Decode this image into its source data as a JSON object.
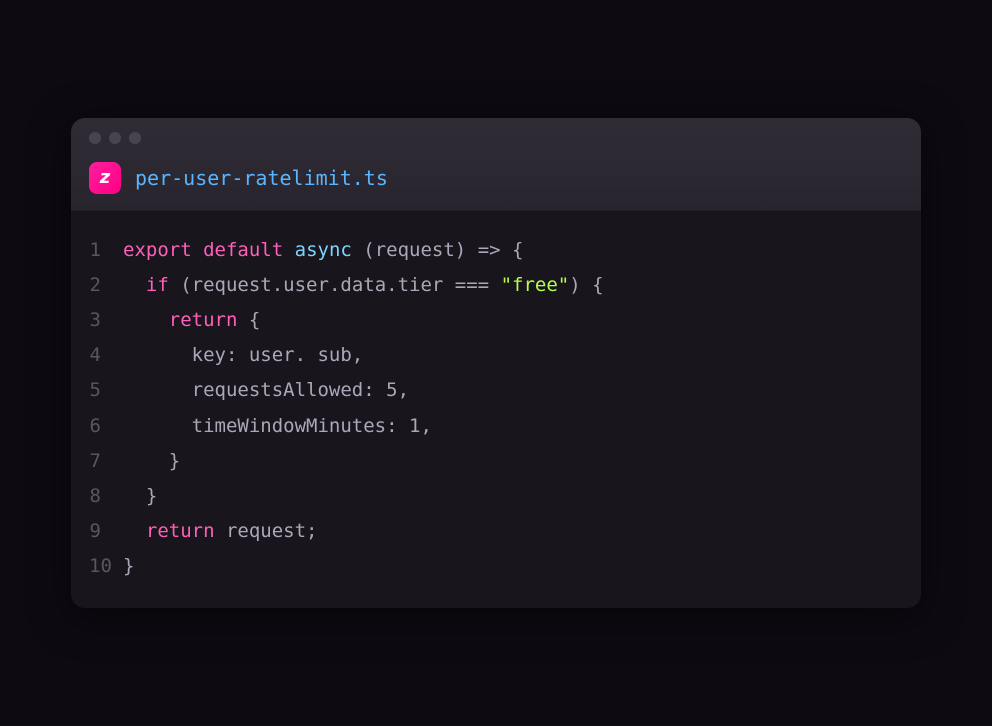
{
  "app_icon_glyph": "z",
  "filename": "per-user-ratelimit.ts",
  "code": {
    "lines": [
      {
        "num": "1",
        "tokens": [
          {
            "t": "export",
            "c": "key"
          },
          {
            "t": " ",
            "c": "pun"
          },
          {
            "t": "default",
            "c": "key"
          },
          {
            "t": " ",
            "c": "pun"
          },
          {
            "t": "async",
            "c": "mod"
          },
          {
            "t": " (",
            "c": "pun"
          },
          {
            "t": "request",
            "c": "id"
          },
          {
            "t": ") ",
            "c": "pun"
          },
          {
            "t": "=>",
            "c": "op"
          },
          {
            "t": " {",
            "c": "pun"
          }
        ]
      },
      {
        "num": "2",
        "tokens": [
          {
            "t": "  ",
            "c": "pun"
          },
          {
            "t": "if",
            "c": "key"
          },
          {
            "t": " (",
            "c": "pun"
          },
          {
            "t": "request.user.data.tier",
            "c": "id"
          },
          {
            "t": " ",
            "c": "pun"
          },
          {
            "t": "===",
            "c": "op"
          },
          {
            "t": " ",
            "c": "pun"
          },
          {
            "t": "\"free\"",
            "c": "str"
          },
          {
            "t": ") {",
            "c": "pun"
          }
        ]
      },
      {
        "num": "3",
        "tokens": [
          {
            "t": "    ",
            "c": "pun"
          },
          {
            "t": "return",
            "c": "key"
          },
          {
            "t": " {",
            "c": "pun"
          }
        ]
      },
      {
        "num": "4",
        "tokens": [
          {
            "t": "      key: user. sub,",
            "c": "id"
          }
        ]
      },
      {
        "num": "5",
        "tokens": [
          {
            "t": "      requestsAllowed: ",
            "c": "id"
          },
          {
            "t": "5",
            "c": "num"
          },
          {
            "t": ",",
            "c": "pun"
          }
        ]
      },
      {
        "num": "6",
        "tokens": [
          {
            "t": "      timeWindowMinutes: ",
            "c": "id"
          },
          {
            "t": "1",
            "c": "num"
          },
          {
            "t": ",",
            "c": "pun"
          }
        ]
      },
      {
        "num": "7",
        "tokens": [
          {
            "t": "    }",
            "c": "pun"
          }
        ]
      },
      {
        "num": "8",
        "tokens": [
          {
            "t": "  }",
            "c": "pun"
          }
        ]
      },
      {
        "num": "9",
        "tokens": [
          {
            "t": "  ",
            "c": "pun"
          },
          {
            "t": "return",
            "c": "key"
          },
          {
            "t": " request;",
            "c": "id"
          }
        ]
      },
      {
        "num": "10",
        "tokens": [
          {
            "t": "}",
            "c": "pun"
          }
        ]
      }
    ]
  }
}
